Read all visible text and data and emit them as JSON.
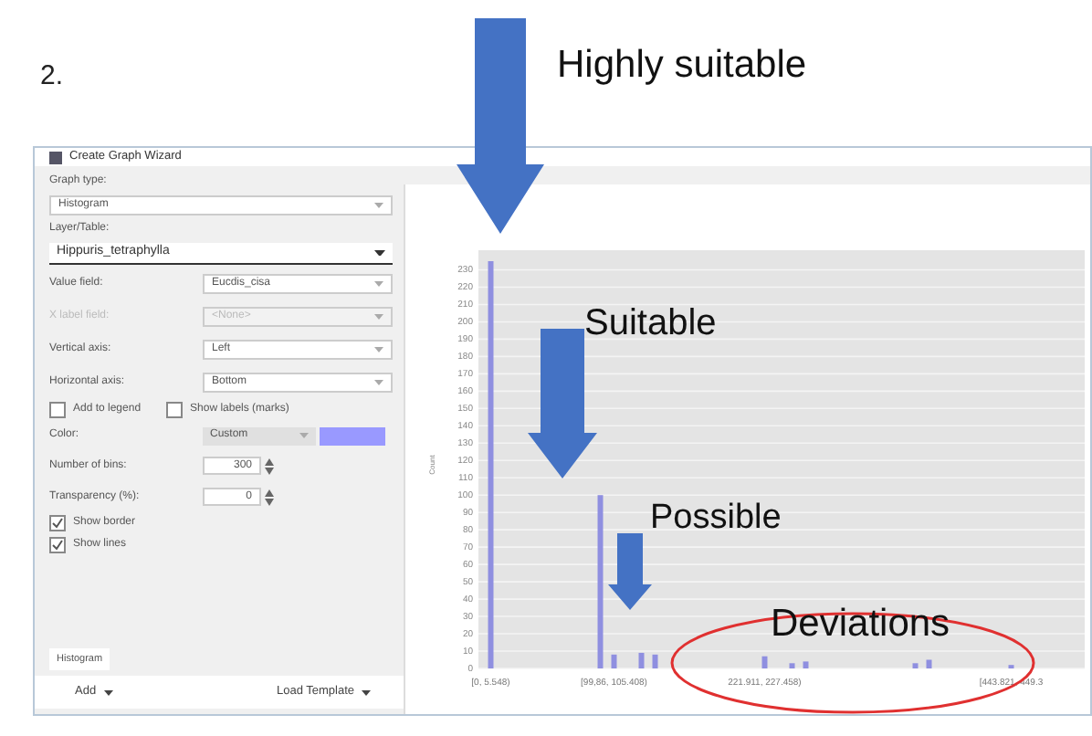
{
  "figure_number": "2.",
  "window": {
    "title": "Create Graph Wizard"
  },
  "form": {
    "graph_type_label": "Graph type:",
    "graph_type": "Histogram",
    "layer_label": "Layer/Table:",
    "layer": "Hippuris_tetraphylla",
    "fields": [
      {
        "label": "Value field:",
        "value": "Eucdis_cisa",
        "disabled": false
      },
      {
        "label": "X label field:",
        "value": "<None>",
        "disabled": true
      },
      {
        "label": "Vertical axis:",
        "value": "Left",
        "disabled": false
      },
      {
        "label": "Horizontal axis:",
        "value": "Bottom",
        "disabled": false
      }
    ],
    "legend_checks": [
      {
        "label": "Add to legend",
        "checked": false
      },
      {
        "label": "Show labels (marks)",
        "checked": false
      }
    ],
    "color_label": "Color:",
    "color_mode": "Custom",
    "color": "#9999ff",
    "bins_label": "Number of bins:",
    "bins": "300",
    "transparency_label": "Transparency (%):",
    "transparency": "0",
    "style_checks": [
      {
        "label": "Show border",
        "checked": true
      },
      {
        "label": "Show lines",
        "checked": true
      }
    ],
    "tabs": [
      {
        "label": "Histogram",
        "selected": true
      }
    ],
    "add_button": "Add",
    "template_button": "Load Template"
  },
  "chart_data": {
    "type": "bar",
    "ylabel": "Count",
    "ylim": [
      0,
      235
    ],
    "categories": [
      "[0, 5.548)",
      null,
      null,
      null,
      null,
      null,
      null,
      null,
      null,
      "[99,86, 105.408)",
      null,
      null,
      null,
      null,
      null,
      null,
      null,
      null,
      null,
      null,
      "221.911, 227.458)",
      null,
      null,
      null,
      null,
      null,
      null,
      null,
      null,
      null,
      null,
      null,
      null,
      null,
      null,
      null,
      null,
      null,
      "[443.821, 449.3",
      null
    ],
    "grid": true,
    "series": [
      {
        "color": "#8f8fe0",
        "values": [
          235,
          null,
          null,
          null,
          null,
          null,
          null,
          null,
          100,
          8,
          null,
          9,
          8,
          null,
          null,
          null,
          null,
          null,
          null,
          null,
          7,
          null,
          3,
          4,
          null,
          null,
          null,
          null,
          null,
          null,
          null,
          3,
          5,
          null,
          null,
          null,
          null,
          null,
          2,
          null
        ]
      }
    ],
    "yticks": [
      0,
      10,
      20,
      30,
      40,
      50,
      60,
      70,
      80,
      90,
      100,
      110,
      120,
      130,
      140,
      150,
      160,
      170,
      180,
      190,
      200,
      210,
      220,
      230
    ]
  },
  "annotations": [
    {
      "kind": "arrow-label",
      "text": "Highly suitable"
    },
    {
      "kind": "arrow-label",
      "text": "Suitable"
    },
    {
      "kind": "arrow-label",
      "text": "Possible"
    },
    {
      "kind": "ellipse-label",
      "text": "Deviations"
    }
  ]
}
